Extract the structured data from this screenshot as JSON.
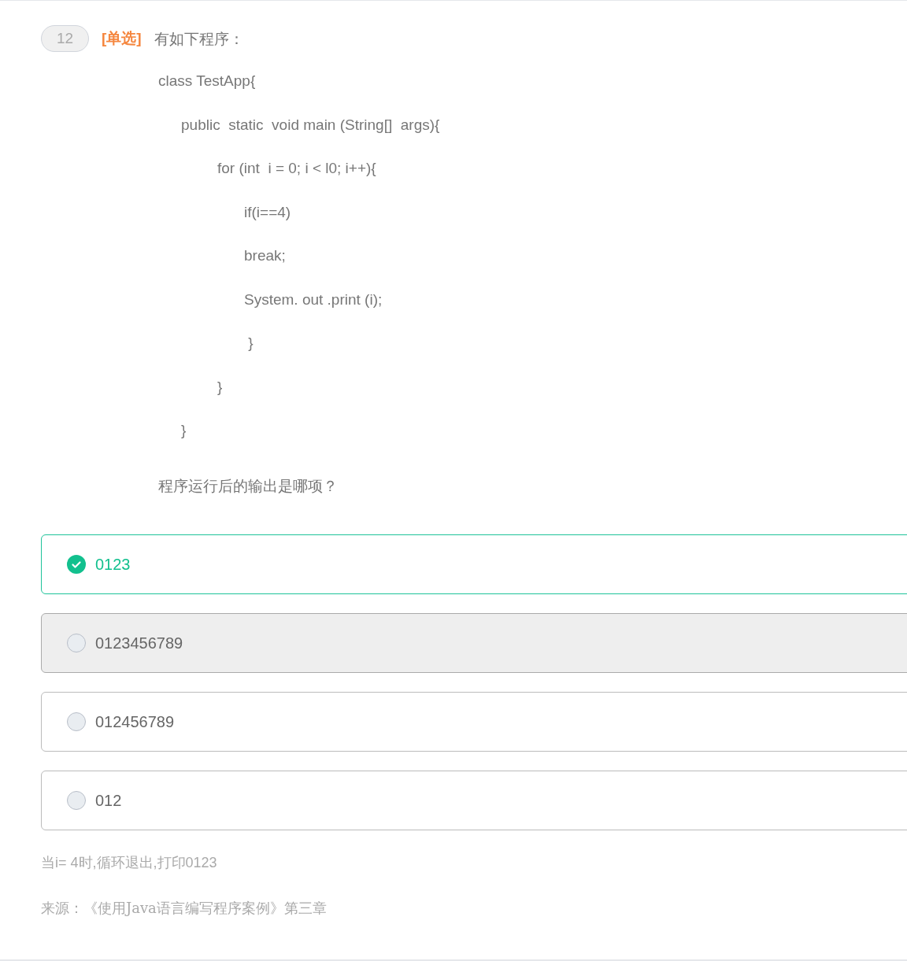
{
  "question": {
    "number": "12",
    "type_tag": "[单选]",
    "prompt": "有如下程序：",
    "code": [
      {
        "text": "class TestApp{",
        "children": [
          {
            "text": "public  static  void main (String[]  args){",
            "children": [
              {
                "text": "for (int  i = 0; i < l0; i++){",
                "children": [
                  {
                    "text": "if(i==4)"
                  },
                  {
                    "text": "break;"
                  },
                  {
                    "text": "System. out .print (i);"
                  },
                  {
                    "text": " }"
                  }
                ]
              },
              {
                "text": "}"
              }
            ]
          },
          {
            "text": "}"
          }
        ]
      }
    ],
    "ask": "程序运行后的输出是哪项？"
  },
  "options": [
    {
      "label": "0123",
      "selected": true,
      "highlighted": false
    },
    {
      "label": "0123456789",
      "selected": false,
      "highlighted": true
    },
    {
      "label": "012456789",
      "selected": false,
      "highlighted": false
    },
    {
      "label": "012",
      "selected": false,
      "highlighted": false
    }
  ],
  "explanation": "当i= 4时,循环退出,打印0123",
  "source": "来源：《使用Java语言编写程序案例》第三章"
}
